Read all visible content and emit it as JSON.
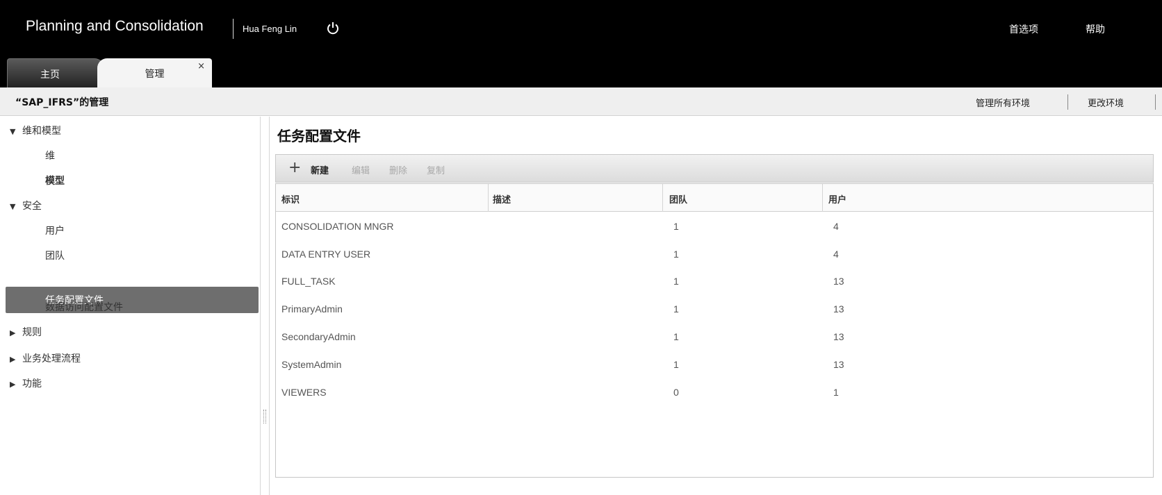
{
  "header": {
    "app_title": "Planning and Consolidation",
    "user_name": "Hua Feng Lin",
    "options_label": "首选项",
    "help_label": "帮助"
  },
  "tabs": [
    {
      "label": "主页"
    },
    {
      "label": "管理",
      "close": "×"
    }
  ],
  "context": {
    "title": "“SAP_IFRS”的管理",
    "manage_all_label": "管理所有环境",
    "change_env_label": "更改环境"
  },
  "sidebar": {
    "groups": [
      {
        "label": "维和模型",
        "expanded": true,
        "children": [
          "维",
          "模型"
        ]
      },
      {
        "label": "安全",
        "expanded": true,
        "children": [
          "用户",
          "团队",
          "任务配置文件",
          "数据访问配置文件"
        ]
      },
      {
        "label": "规则",
        "expanded": false
      },
      {
        "label": "业务处理流程",
        "expanded": false
      },
      {
        "label": "功能",
        "expanded": false
      }
    ],
    "selected": "任务配置文件"
  },
  "main": {
    "title": "任务配置文件",
    "toolbar": {
      "new_label": "新建",
      "edit_label": "编辑",
      "delete_label": "删除",
      "copy_label": "复制"
    },
    "columns": [
      "标识",
      "描述",
      "团队",
      "用户"
    ],
    "rows": [
      [
        "CONSOLIDATION MNGR",
        "",
        "1",
        "4"
      ],
      [
        "DATA ENTRY USER",
        "",
        "1",
        "4"
      ],
      [
        "FULL_TASK",
        "",
        "1",
        "13"
      ],
      [
        "PrimaryAdmin",
        "",
        "1",
        "13"
      ],
      [
        "SecondaryAdmin",
        "",
        "1",
        "13"
      ],
      [
        "SystemAdmin",
        "",
        "1",
        "13"
      ],
      [
        "VIEWERS",
        "",
        "0",
        "1"
      ]
    ]
  },
  "icons": {
    "power": "power-icon",
    "plus": "plus-icon"
  }
}
